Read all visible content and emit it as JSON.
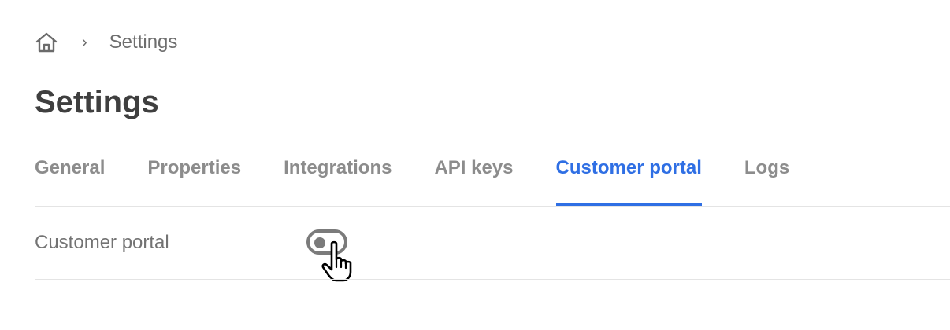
{
  "breadcrumb": {
    "home_icon": "home-icon",
    "separator": "›",
    "current": "Settings"
  },
  "page": {
    "title": "Settings"
  },
  "tabs": [
    {
      "label": "General",
      "active": false
    },
    {
      "label": "Properties",
      "active": false
    },
    {
      "label": "Integrations",
      "active": false
    },
    {
      "label": "API keys",
      "active": false
    },
    {
      "label": "Customer portal",
      "active": true
    },
    {
      "label": "Logs",
      "active": false
    }
  ],
  "settings": {
    "customer_portal": {
      "label": "Customer portal",
      "toggle_state": "off"
    }
  },
  "colors": {
    "accent": "#2f6fe4",
    "title": "#3f3f3f",
    "muted": "#8c8c8c",
    "toggle": "#7b7b7b"
  }
}
